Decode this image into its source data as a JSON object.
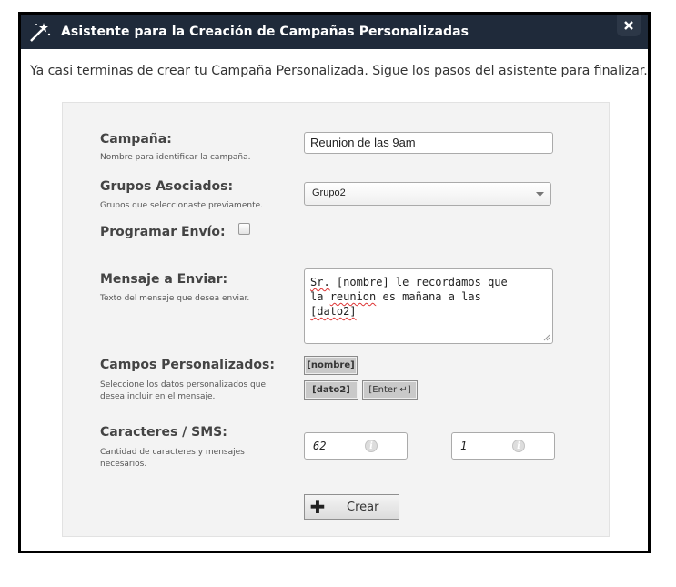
{
  "dialog": {
    "title": "Asistente para la Creación de Campañas Personalizadas",
    "intro": "Ya casi terminas de crear tu Campaña Personalizada. Sigue los pasos del asistente para finalizar."
  },
  "form": {
    "campana": {
      "label": "Campaña:",
      "hint": "Nombre para identificar la campaña.",
      "value": "Reunion de las 9am"
    },
    "grupos": {
      "label": "Grupos Asociados:",
      "hint": "Grupos que seleccionaste previamente.",
      "selected": "Grupo2"
    },
    "programar": {
      "label": "Programar Envío:",
      "checked": false
    },
    "mensaje": {
      "label": "Mensaje a Enviar:",
      "hint": "Texto del mensaje que desea enviar.",
      "value_parts": [
        "Sr.",
        " [nombre] le recordamos que",
        "la ",
        "reunion",
        " es mañana a las",
        "[dato2]"
      ]
    },
    "campos": {
      "label": "Campos Personalizados:",
      "hint_line1": "Seleccione los datos personalizados que",
      "hint_line2": "desea incluir  en el mensaje.",
      "tags": [
        "[nombre]",
        "[dato2]",
        "[Enter ↵]"
      ]
    },
    "caracteres": {
      "label": "Caracteres / SMS:",
      "hint_line1": "Cantidad de caracteres y mensajes",
      "hint_line2": "necesarios.",
      "chars": "62",
      "sms": "1"
    },
    "crear_label": "Crear"
  },
  "icons": {
    "title": "magic-wand-icon",
    "close": "close-icon",
    "info": "info-icon",
    "add": "plus-icon",
    "dropdown": "caret-down-icon"
  },
  "colors": {
    "titlebar": "#1f2a3a",
    "panel": "#f3f3f3"
  }
}
